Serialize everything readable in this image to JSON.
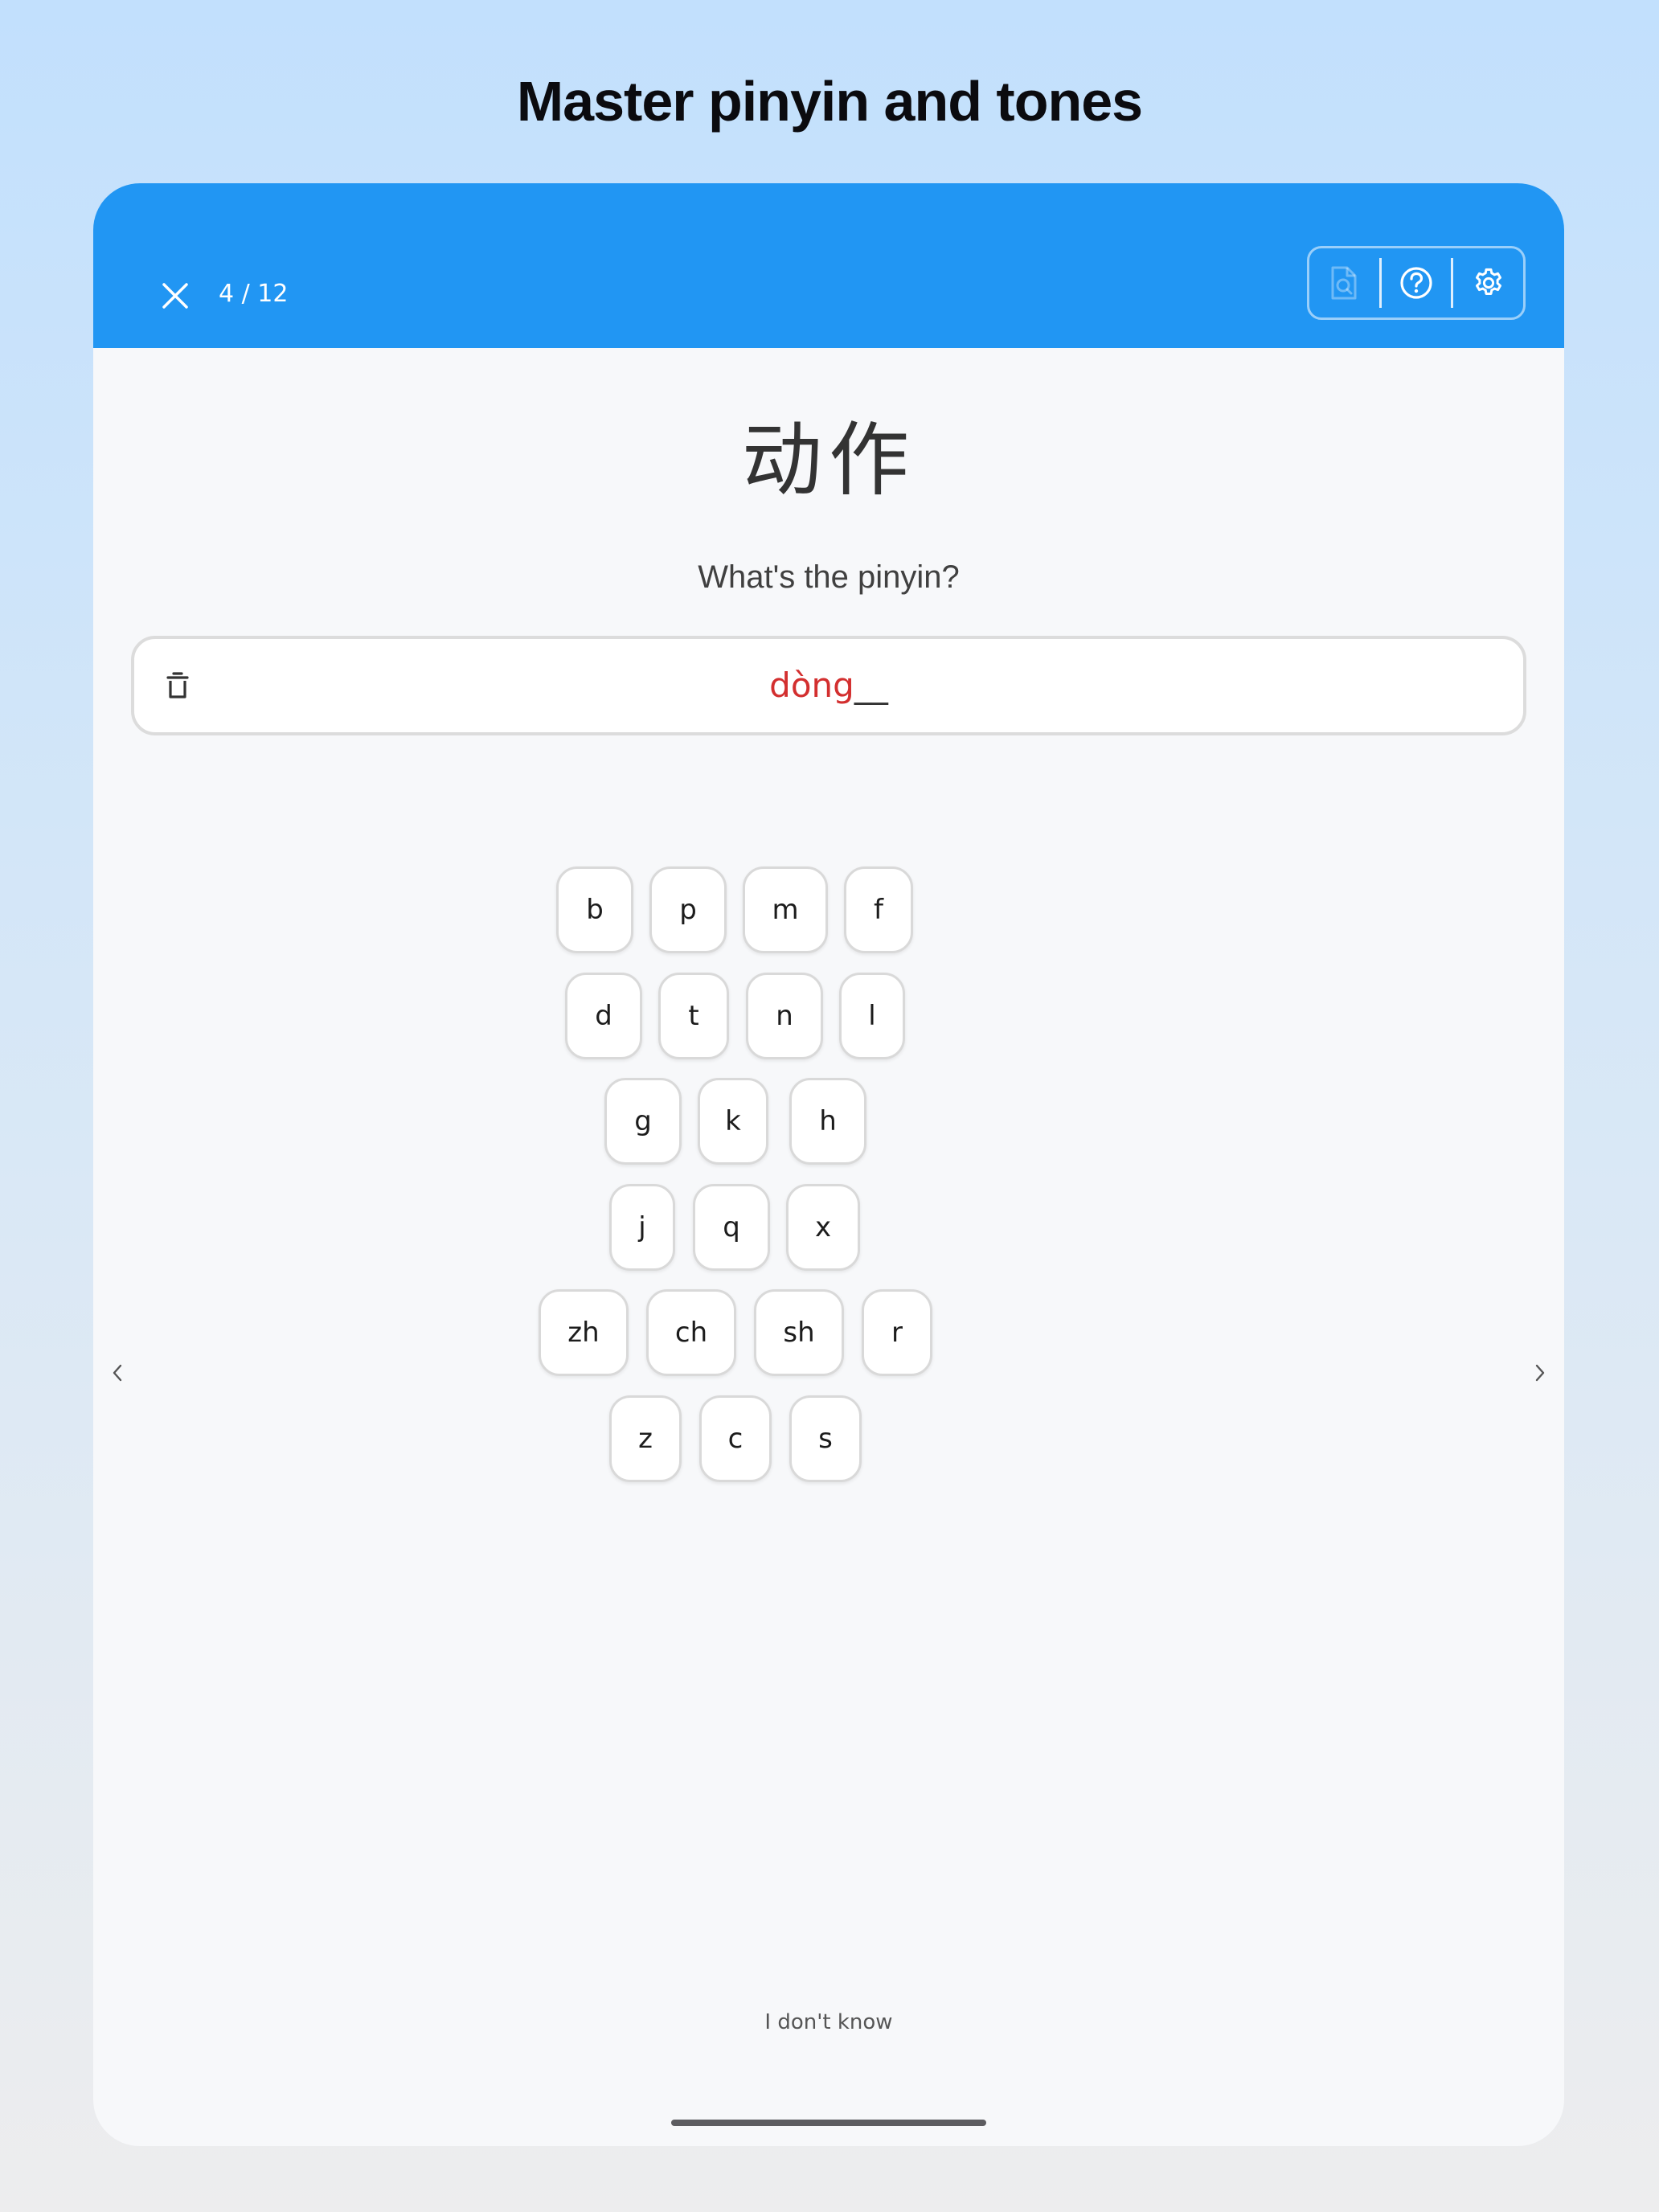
{
  "page": {
    "headline": "Master pinyin and tones"
  },
  "header": {
    "progress": "4 / 12",
    "tools": [
      {
        "icon": "document-search-icon",
        "enabled": false
      },
      {
        "icon": "help-circle-icon",
        "enabled": true
      },
      {
        "icon": "gear-icon",
        "enabled": true
      }
    ]
  },
  "question": {
    "characters": "动作",
    "prompt": "What's the pinyin?"
  },
  "answer": {
    "typed": "dòng",
    "blank": "__"
  },
  "keyboard": {
    "rows": [
      [
        "b",
        "p",
        "m",
        "f"
      ],
      [
        "d",
        "t",
        "n",
        "l"
      ],
      [
        "g",
        "k",
        "h"
      ],
      [
        "j",
        "q",
        "x"
      ],
      [
        "zh",
        "ch",
        "sh",
        "r"
      ],
      [
        "z",
        "c",
        "s"
      ]
    ]
  },
  "footer": {
    "dont_know": "I don't know"
  },
  "colors": {
    "header_bg": "#2196f3",
    "answer_typed": "#d32f2f",
    "card_bg": "#f7f8fa"
  }
}
